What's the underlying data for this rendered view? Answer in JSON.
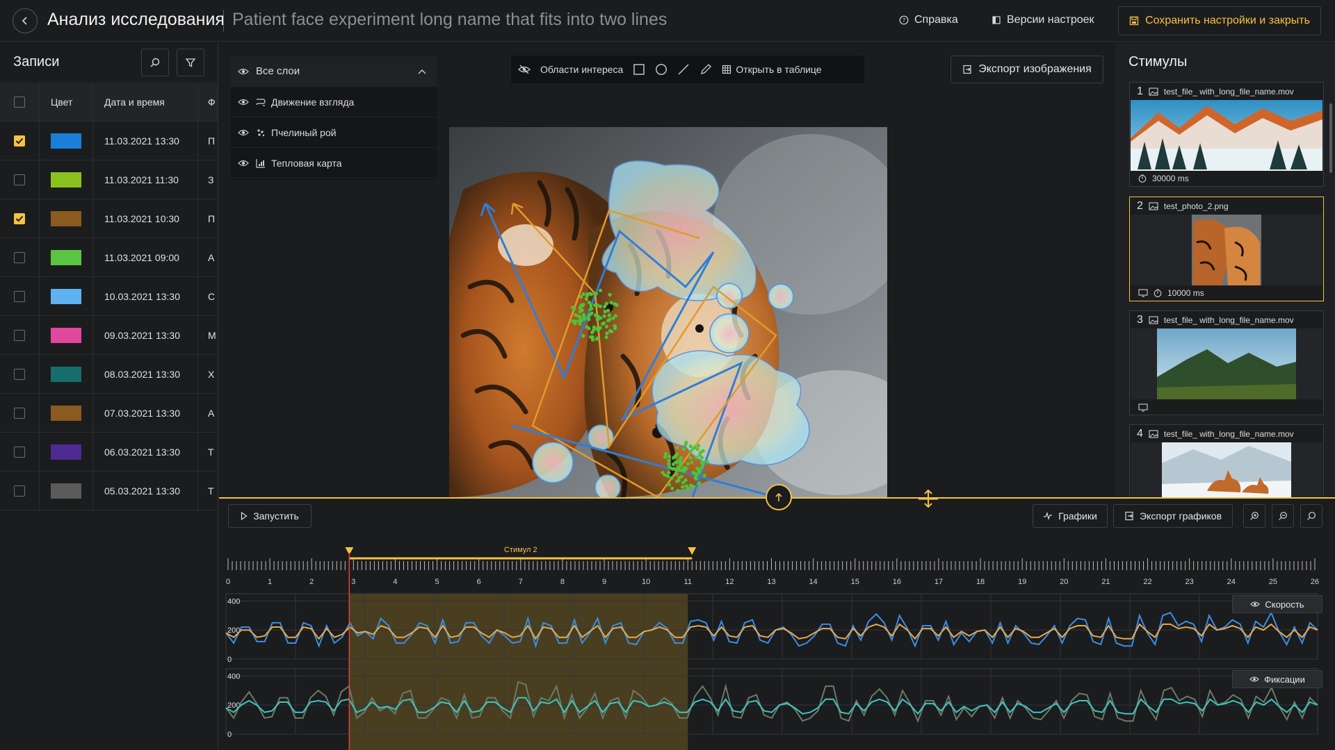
{
  "header": {
    "app_title": "Анализ исследования",
    "experiment_name": "Patient face experiment long name that fits into two lines",
    "help_label": "Справка",
    "versions_label": "Версии настроек",
    "save_label": "Сохранить настройки и закрыть"
  },
  "records": {
    "title": "Записи",
    "columns": [
      "Цвет",
      "Дата и время",
      "Ф"
    ],
    "rows": [
      {
        "checked": true,
        "color": "#1a7fd9",
        "datetime": "11.03.2021  13:30",
        "name": "П"
      },
      {
        "checked": false,
        "color": "#8cc21e",
        "datetime": "11.03.2021  11:30",
        "name": "З"
      },
      {
        "checked": true,
        "color": "#8a5a1e",
        "datetime": "11.03.2021  10:30",
        "name": "П"
      },
      {
        "checked": false,
        "color": "#5cc443",
        "datetime": "11.03.2021  09:00",
        "name": "А"
      },
      {
        "checked": false,
        "color": "#5fb2f0",
        "datetime": "10.03.2021  13:30",
        "name": "С"
      },
      {
        "checked": false,
        "color": "#e0479e",
        "datetime": "09.03.2021  13:30",
        "name": "М"
      },
      {
        "checked": false,
        "color": "#166e6c",
        "datetime": "08.03.2021  13:30",
        "name": "Х"
      },
      {
        "checked": false,
        "color": "#8a5a1e",
        "datetime": "07.03.2021  13:30",
        "name": "А"
      },
      {
        "checked": false,
        "color": "#4e2a93",
        "datetime": "06.03.2021  13:30",
        "name": "Т"
      },
      {
        "checked": false,
        "color": "#5b5b5b",
        "datetime": "05.03.2021  13:30",
        "name": "Т"
      }
    ]
  },
  "layers": {
    "all_label": "Все слои",
    "items": [
      {
        "label": "Движение взгляда",
        "icon": "gaze-path-icon"
      },
      {
        "label": "Пчелиный рой",
        "icon": "bee-swarm-icon"
      },
      {
        "label": "Тепловая карта",
        "icon": "heatmap-icon"
      }
    ]
  },
  "toolbar": {
    "roi_label": "Области интереса",
    "open_table_label": "Открыть в таблице",
    "export_image_label": "Экспорт изображения"
  },
  "stimuli": {
    "title": "Стимулы",
    "items": [
      {
        "num": "1",
        "name": "test_file_ with_long_file_name.mov",
        "duration": "30000 ms",
        "selected": false
      },
      {
        "num": "2",
        "name": "test_photo_2.png",
        "duration": "10000 ms",
        "selected": true
      },
      {
        "num": "3",
        "name": "test_file_ with_long_file_name.mov",
        "duration": "",
        "selected": false
      },
      {
        "num": "4",
        "name": "test_file_ with_long_file_name.mov",
        "duration": "",
        "selected": false
      }
    ]
  },
  "bottom": {
    "run_label": "Запустить",
    "charts_label": "Графики",
    "export_charts_label": "Экспорт графиков",
    "stimulus_marker_label": "Стимул 2",
    "speed_label": "Скорость",
    "fixations_label": "Фиксации"
  },
  "chart_data": {
    "type": "line",
    "x_ticks": [
      0,
      1,
      2,
      3,
      4,
      5,
      6,
      7,
      8,
      9,
      10,
      11,
      12,
      13,
      14,
      15,
      16,
      17,
      18,
      19,
      20,
      21,
      22,
      23,
      24,
      25,
      26
    ],
    "highlight_range": [
      3,
      11
    ],
    "cursor_x": 2.9,
    "charts": [
      {
        "name": "Скорость",
        "y_ticks": [
          0,
          200,
          400
        ],
        "ylim": [
          0,
          450
        ],
        "series": [
          {
            "color": "#3a8ee6",
            "values": [
              180,
              110,
              220,
              220,
              120,
              120,
              250,
              250,
              110,
              110,
              250,
              230,
              90,
              230,
              110,
              150,
              250,
              160,
              190,
              140,
              280,
              230,
              110,
              110,
              170,
              250,
              230,
              110,
              270,
              110,
              120,
              250,
              250,
              160,
              110,
              200,
              160,
              110,
              120,
              280,
              90,
              250,
              230,
              110,
              110,
              270,
              110,
              180,
              280,
              110,
              230,
              250,
              110,
              100,
              190,
              200,
              250,
              210,
              110,
              110,
              260,
              270,
              250,
              130,
              260,
              120,
              110,
              250,
              270,
              130,
              110,
              200,
              220,
              170,
              90,
              110,
              160,
              240,
              240,
              110,
              90,
              230,
              130,
              260,
              310,
              250,
              130,
              300,
              210,
              90,
              230,
              230,
              130,
              260,
              100,
              180,
              120,
              190,
              200,
              110,
              250,
              110,
              230,
              180,
              110,
              100,
              160,
              230,
              110,
              230,
              280,
              270,
              120,
              100,
              280,
              110,
              90,
              90,
              300,
              180,
              100,
              300,
              320,
              230,
              260,
              240,
              120,
              300,
              200,
              220,
              270,
              240,
              110,
              260,
              220,
              320,
              190,
              100,
              220,
              110,
              250,
              200
            ]
          },
          {
            "color": "#e9a94a",
            "values": [
              180,
              150,
              200,
              200,
              150,
              160,
              220,
              220,
              150,
              150,
              220,
              210,
              140,
              210,
              150,
              170,
              220,
              180,
              190,
              170,
              230,
              210,
              150,
              150,
              180,
              220,
              210,
              150,
              230,
              150,
              160,
              220,
              220,
              180,
              150,
              200,
              180,
              150,
              160,
              230,
              140,
              220,
              210,
              150,
              150,
              230,
              150,
              190,
              230,
              150,
              210,
              220,
              150,
              150,
              190,
              200,
              220,
              200,
              150,
              150,
              220,
              230,
              220,
              160,
              220,
              160,
              150,
              220,
              230,
              160,
              150,
              200,
              210,
              180,
              140,
              150,
              180,
              210,
              210,
              150,
              140,
              210,
              160,
              220,
              240,
              220,
              160,
              240,
              200,
              140,
              210,
              210,
              160,
              220,
              150,
              190,
              160,
              190,
              200,
              150,
              220,
              150,
              210,
              190,
              150,
              150,
              180,
              210,
              150,
              210,
              230,
              230,
              160,
              150,
              230,
              150,
              140,
              140,
              240,
              190,
              150,
              240,
              240,
              210,
              220,
              210,
              160,
              240,
              200,
              210,
              230,
              210,
              150,
              220,
              200,
              240,
              190,
              150,
              200,
              150,
              220,
              200
            ]
          }
        ]
      },
      {
        "name": "Фиксации",
        "y_ticks": [
          0,
          200,
          400
        ],
        "ylim": [
          0,
          450
        ],
        "series": [
          {
            "color": "#6d7a6a",
            "values": [
              180,
              110,
              220,
              290,
              210,
              110,
              120,
              250,
              250,
              110,
              110,
              250,
              300,
              260,
              130,
              290,
              330,
              110,
              150,
              250,
              160,
              190,
              140,
              280,
              300,
              110,
              110,
              170,
              250,
              230,
              110,
              270,
              110,
              120,
              250,
              250,
              160,
              110,
              360,
              340,
              120,
              250,
              230,
              330,
              110,
              270,
              110,
              180,
              280,
              110,
              230,
              250,
              110,
              300,
              260,
              190,
              200,
              250,
              210,
              110,
              110,
              260,
              330,
              250,
              130,
              330,
              120,
              110,
              250,
              270,
              130,
              110,
              200,
              220,
              170,
              90,
              110,
              160,
              330,
              330,
              110,
              90,
              230,
              130,
              260,
              310,
              250,
              130,
              300,
              210,
              90,
              230,
              230,
              130,
              260,
              100,
              180,
              120,
              190,
              200,
              110,
              250,
              110,
              230,
              180,
              110,
              100,
              160,
              230,
              110,
              230,
              280,
              270,
              120,
              100,
              280,
              110,
              90,
              90,
              300,
              180,
              100,
              300,
              320,
              230,
              260,
              240,
              120,
              300,
              200,
              220,
              270,
              240,
              110,
              260,
              220,
              320,
              190,
              100,
              220,
              110,
              250,
              200
            ]
          },
          {
            "color": "#3cc6c0",
            "values": [
              180,
              150,
              200,
              230,
              200,
              150,
              160,
              220,
              220,
              150,
              150,
              220,
              230,
              220,
              160,
              230,
              240,
              150,
              170,
              220,
              180,
              190,
              170,
              230,
              240,
              150,
              150,
              180,
              220,
              210,
              150,
              230,
              150,
              160,
              220,
              220,
              180,
              150,
              250,
              250,
              160,
              220,
              210,
              240,
              150,
              230,
              150,
              190,
              230,
              150,
              210,
              220,
              150,
              230,
              220,
              190,
              200,
              220,
              200,
              150,
              150,
              220,
              240,
              220,
              160,
              240,
              160,
              150,
              220,
              230,
              160,
              150,
              200,
              210,
              180,
              140,
              150,
              180,
              240,
              240,
              150,
              140,
              210,
              160,
              220,
              240,
              220,
              160,
              240,
              200,
              140,
              210,
              210,
              160,
              220,
              150,
              190,
              160,
              190,
              200,
              150,
              220,
              150,
              210,
              190,
              150,
              150,
              180,
              210,
              150,
              210,
              230,
              230,
              160,
              150,
              230,
              150,
              140,
              140,
              240,
              190,
              150,
              240,
              240,
              210,
              220,
              210,
              160,
              240,
              200,
              210,
              230,
              210,
              150,
              220,
              200,
              240,
              190,
              150,
              200,
              150,
              220,
              200
            ]
          }
        ]
      }
    ]
  }
}
